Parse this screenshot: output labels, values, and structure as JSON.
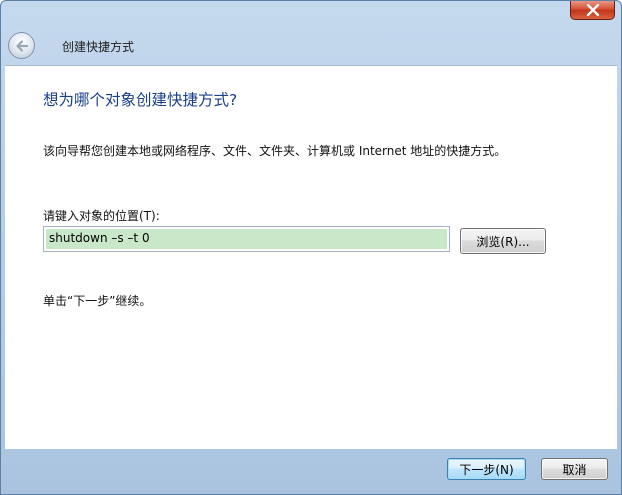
{
  "window": {
    "title": "创建快捷方式"
  },
  "titlebar": {
    "close_icon": "close-icon",
    "back_icon": "back-arrow-icon"
  },
  "page": {
    "heading": "想为哪个对象创建快捷方式?",
    "description": "该向导帮您创建本地或网络程序、文件、文件夹、计算机或 Internet 地址的快捷方式。",
    "location_label": "请键入对象的位置(T):",
    "location_value": "shutdown –s –t 0",
    "browse_label": "浏览(R)...",
    "hint": "单击“下一步”继续。"
  },
  "footer": {
    "next_label": "下一步(N)",
    "cancel_label": "取消"
  },
  "colors": {
    "heading": "#1b3f8c",
    "input_highlight": "#c9e8c9",
    "close_button": "#c3341c"
  }
}
